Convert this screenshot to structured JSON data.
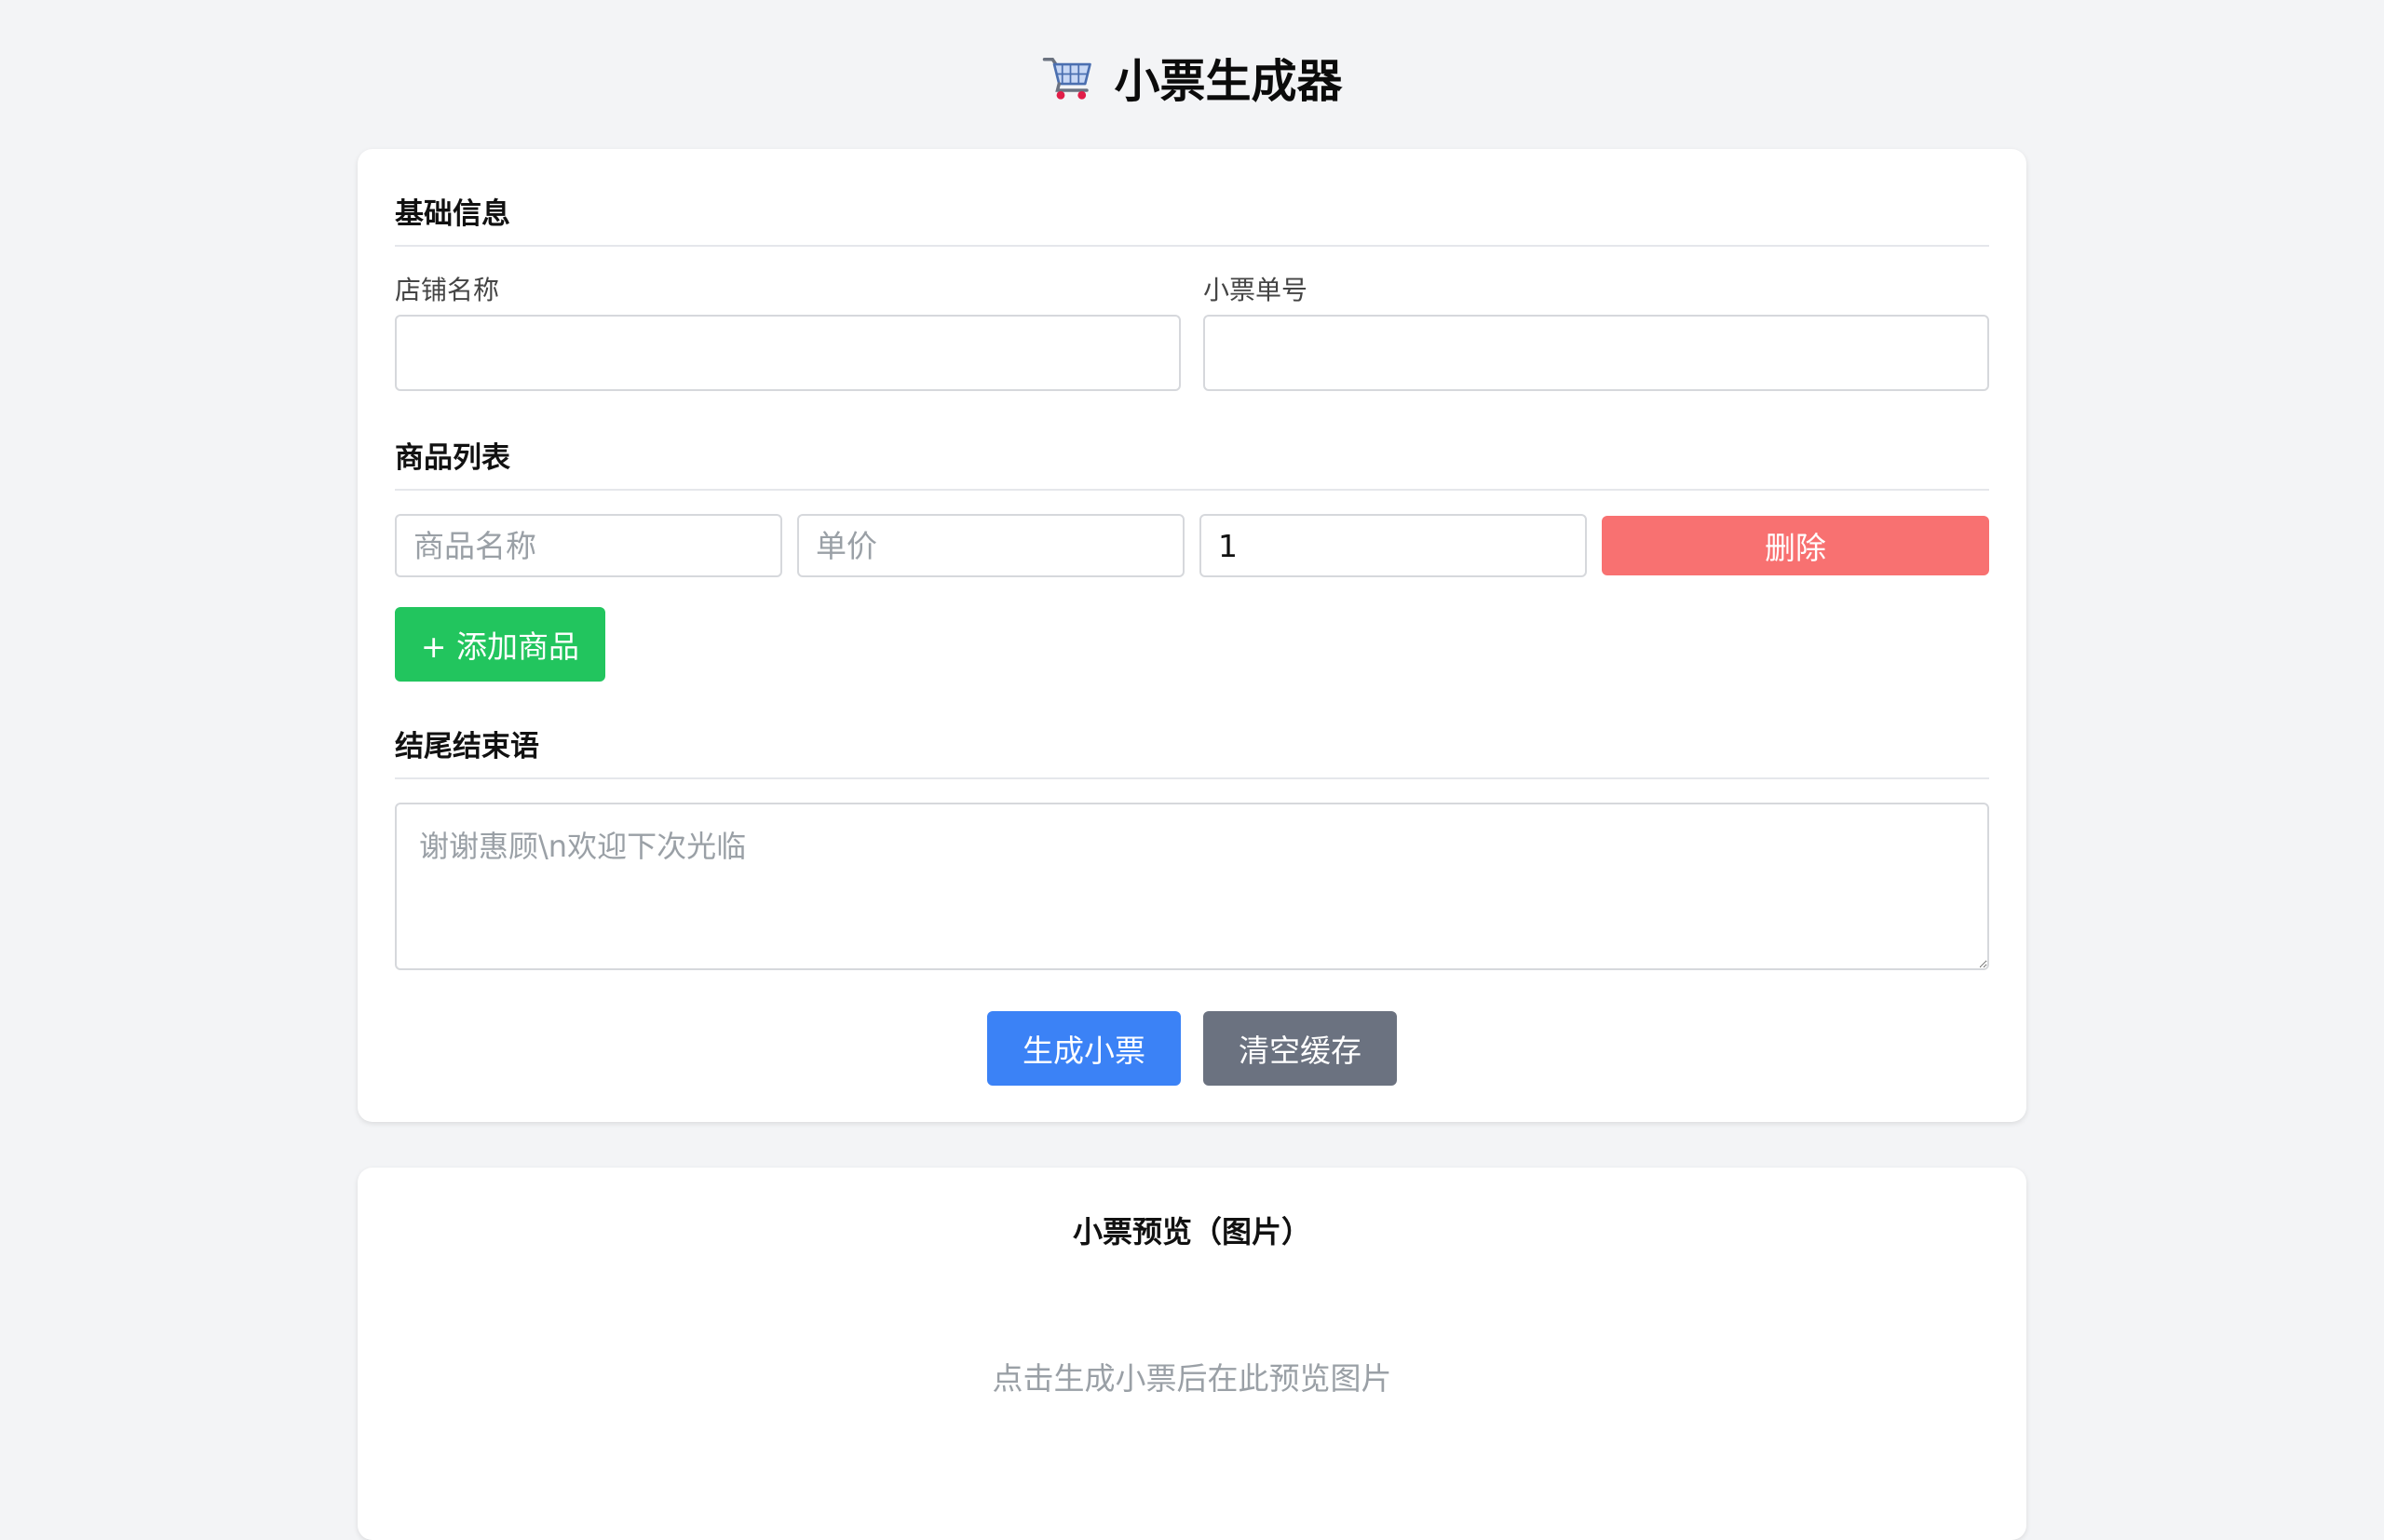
{
  "header": {
    "title": "小票生成器",
    "icon": "shopping-cart-icon"
  },
  "basic_info": {
    "section_title": "基础信息",
    "store_name_label": "店铺名称",
    "store_name_value": "",
    "receipt_no_label": "小票单号",
    "receipt_no_value": ""
  },
  "items": {
    "section_title": "商品列表",
    "rows": [
      {
        "name_placeholder": "商品名称",
        "price_placeholder": "单价",
        "quantity": "1",
        "delete_label": "删除"
      }
    ],
    "add_label": "+ 添加商品"
  },
  "footer": {
    "section_title": "结尾结束语",
    "placeholder": "谢谢惠顾\\n欢迎下次光临"
  },
  "actions": {
    "generate_label": "生成小票",
    "clear_label": "清空缓存"
  },
  "preview": {
    "title": "小票预览（图片）",
    "hint": "点击生成小票后在此预览图片"
  },
  "colors": {
    "background": "#f3f4f6",
    "delete": "#f87171",
    "add": "#22c55e",
    "generate": "#3b82f6",
    "clear": "#6b7280"
  }
}
